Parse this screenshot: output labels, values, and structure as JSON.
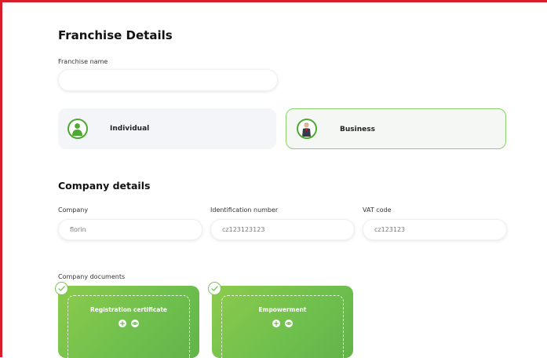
{
  "franchise": {
    "title": "Franchise Details",
    "name_label": "Franchise name",
    "name_value": "",
    "types": [
      {
        "label": "Individual",
        "selected": false,
        "icon": "person-icon"
      },
      {
        "label": "Business",
        "selected": true,
        "icon": "businessman-icon"
      }
    ]
  },
  "company": {
    "title": "Company details",
    "fields": [
      {
        "label": "Company",
        "value": "florin"
      },
      {
        "label": "Identification number",
        "value": "cz123123123"
      },
      {
        "label": "VAT code",
        "value": "cz123123"
      }
    ]
  },
  "documents": {
    "label": "Company documents",
    "items": [
      {
        "title": "Registration certificate",
        "uploaded": true,
        "actions": [
          "add-icon",
          "eye-icon"
        ]
      },
      {
        "title": "Empowerment",
        "uploaded": true,
        "actions": [
          "add-icon",
          "eye-icon"
        ]
      }
    ]
  },
  "colors": {
    "accent_green": "#6ebf4d",
    "frame_red": "#d81e2a"
  }
}
